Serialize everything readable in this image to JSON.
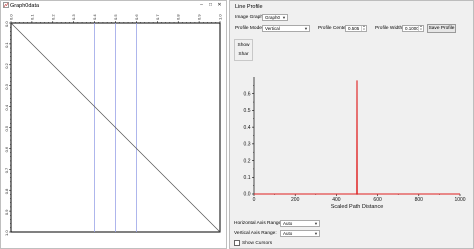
{
  "graph_window": {
    "title": "Graph0data",
    "x_ticks": [
      "0.0",
      "0.1",
      "0.2",
      "0.3",
      "0.4",
      "0.5",
      "0.6",
      "0.7",
      "0.8",
      "0.9",
      "1.0"
    ],
    "y_ticks": [
      "0.0",
      "0.1",
      "0.2",
      "0.3",
      "0.4",
      "0.5",
      "0.6",
      "0.7",
      "0.8",
      "0.9",
      "1.0"
    ],
    "vertical_lines_x": [
      0.4,
      0.5,
      0.6
    ],
    "accent_color": "#9aa3e8"
  },
  "profile_panel": {
    "title": "Line Profile",
    "image_graph_label": "Image Graph:",
    "image_graph_value": "Graph0",
    "profile_mode_label": "Profile Mode:",
    "profile_mode_value": "Vertical",
    "profile_center_label": "Profile Center:",
    "profile_center_value": "0.505",
    "profile_width_label": "Profile Width:",
    "profile_width_value": "0.1000",
    "save_profile_label": "Save Profile",
    "show_label": "Show",
    "show_sub_label": "Shar",
    "h_axis_range_label": "Horizontal Axis Range:",
    "h_axis_range_value": "Auto",
    "v_axis_range_label": "Vertical Axis Range:",
    "v_axis_range_value": "Auto",
    "show_cursors_label": "Show Cursors",
    "show_cursors_checked": false
  },
  "chart_data": {
    "type": "line",
    "xlabel": "Scaled Path Distance",
    "ylabel": "",
    "xlim": [
      0,
      1000
    ],
    "ylim": [
      0,
      0.7
    ],
    "x_ticks": [
      "0",
      "200",
      "400",
      "600",
      "800",
      "1000"
    ],
    "y_ticks": [
      "0.0",
      "0.1",
      "0.2",
      "0.3",
      "0.4",
      "0.5",
      "0.6"
    ],
    "series": [
      {
        "color": "#e02020",
        "x": [
          0,
          499,
          500,
          501,
          1000
        ],
        "y": [
          0,
          0,
          0.68,
          0,
          0
        ]
      }
    ]
  }
}
